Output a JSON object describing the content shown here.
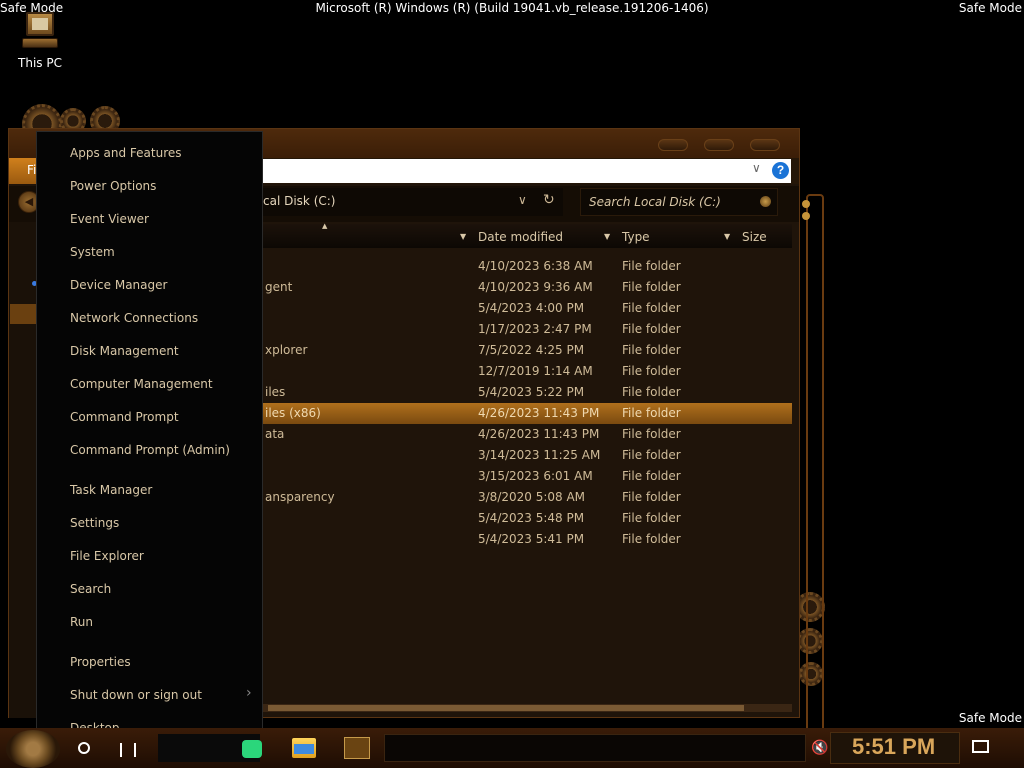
{
  "desktop": {
    "safe_mode_label": "Safe Mode",
    "build_text": "Microsoft (R) Windows (R) (Build 19041.vb_release.191206-1406)",
    "icons": [
      {
        "label": "This PC",
        "icon": "this-pc-icon"
      }
    ]
  },
  "explorer": {
    "ribbon": {
      "file_tab": "Fi"
    },
    "address": {
      "path_visible": "cal Disk (C:)"
    },
    "search": {
      "placeholder": "Search Local Disk (C:)"
    },
    "columns": [
      "Date modified",
      "Type",
      "Size"
    ],
    "rows": [
      {
        "name": "",
        "date": "4/10/2023 6:38 AM",
        "type": "File folder",
        "selected": false
      },
      {
        "name": "gent",
        "date": "4/10/2023 9:36 AM",
        "type": "File folder",
        "selected": false
      },
      {
        "name": "",
        "date": "5/4/2023 4:00 PM",
        "type": "File folder",
        "selected": false
      },
      {
        "name": "",
        "date": "1/17/2023 2:47 PM",
        "type": "File folder",
        "selected": false
      },
      {
        "name": "xplorer",
        "date": "7/5/2022 4:25 PM",
        "type": "File folder",
        "selected": false
      },
      {
        "name": "",
        "date": "12/7/2019 1:14 AM",
        "type": "File folder",
        "selected": false
      },
      {
        "name": "iles",
        "date": "5/4/2023 5:22 PM",
        "type": "File folder",
        "selected": false
      },
      {
        "name": "iles (x86)",
        "date": "4/26/2023 11:43 PM",
        "type": "File folder",
        "selected": true
      },
      {
        "name": "ata",
        "date": "4/26/2023 11:43 PM",
        "type": "File folder",
        "selected": false
      },
      {
        "name": "",
        "date": "3/14/2023 11:25 AM",
        "type": "File folder",
        "selected": false
      },
      {
        "name": "",
        "date": "3/15/2023 6:01 AM",
        "type": "File folder",
        "selected": false
      },
      {
        "name": "ansparency",
        "date": "3/8/2020 5:08 AM",
        "type": "File folder",
        "selected": false
      },
      {
        "name": "",
        "date": "5/4/2023 5:48 PM",
        "type": "File folder",
        "selected": false
      },
      {
        "name": "",
        "date": "5/4/2023 5:41 PM",
        "type": "File folder",
        "selected": false
      }
    ]
  },
  "winx_menu": {
    "items": [
      "Apps and Features",
      "Power Options",
      "Event Viewer",
      "System",
      "Device Manager",
      "Network Connections",
      "Disk Management",
      "Computer Management",
      "Command Prompt",
      "Command Prompt (Admin)",
      "Task Manager",
      "Settings",
      "File Explorer",
      "Search",
      "Run",
      "Properties",
      "Shut down or sign out",
      "Desktop"
    ]
  },
  "taskbar": {
    "clock": "5:51 PM",
    "volume_icon": "volume-muted-icon",
    "notification_icon": "action-center-icon"
  },
  "colors": {
    "accent": "#b0701c",
    "clock": "#d9a65a",
    "menu_bg": "#050505",
    "help": "#1a73d6"
  }
}
